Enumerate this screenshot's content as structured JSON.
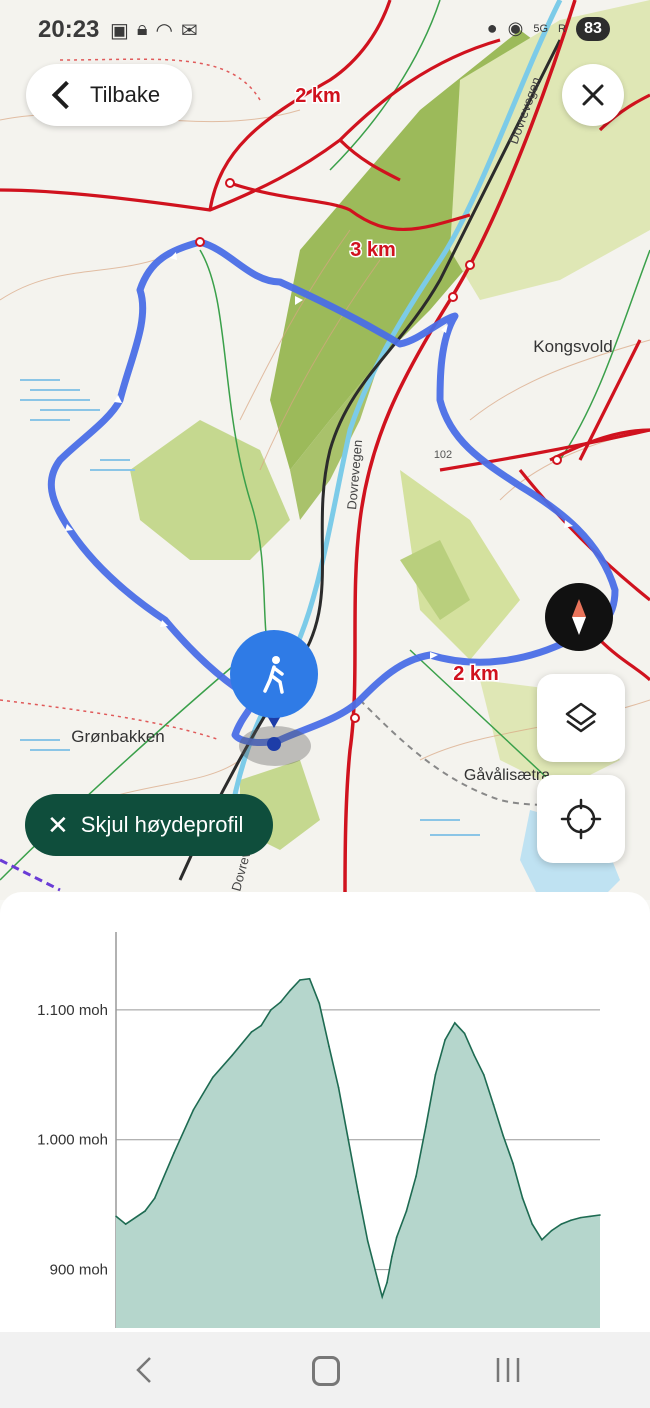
{
  "status_bar": {
    "time": "20:23",
    "left_icons": [
      "screenshot-icon",
      "lock-icon",
      "wifi-icon",
      "mail-icon"
    ],
    "right_icons": [
      "location-icon",
      "hotspot-icon",
      "5g-icon",
      "signal-icon"
    ],
    "battery": "83"
  },
  "header": {
    "back_label": "Tilbake",
    "back_icon": "chevron-left-icon",
    "close_icon": "close-icon"
  },
  "map": {
    "labels": {
      "dist_2km_top": "2 km",
      "dist_3km": "3 km",
      "dist_2km_bottom": "2 km",
      "kongsvold": "Kongsvold",
      "dovrevegen_top": "Dovrevegen",
      "dovrevegen_mid": "Dovrevegen",
      "dovrevegen_bottom": "Dovrevegen",
      "gronbakken": "Grønbakken",
      "gavalisaetra": "Gåvålisætra",
      "elevation_spot": "102"
    },
    "colors": {
      "route": "#4a6ee6",
      "trail": "#d0121e",
      "hiker_marker": "#2f7be6"
    },
    "hiker_icon": "hiker-icon"
  },
  "controls": {
    "compass_icon": "compass-icon",
    "layers_icon": "layers-icon",
    "locate_icon": "crosshair-icon"
  },
  "profile_toggle": {
    "label": "Skjul høydeprofil",
    "icon": "close-icon"
  },
  "chart_data": {
    "type": "area",
    "title": "",
    "xlabel": "",
    "ylabel": "",
    "yticks": [
      "900 moh",
      "1.000 moh",
      "1.100 moh"
    ],
    "ylim": [
      855,
      1160
    ],
    "xlim": [
      0,
      1
    ],
    "grid": true,
    "color": "#b5d6cc",
    "line_color": "#1e6b52",
    "x": [
      0,
      0.02,
      0.06,
      0.08,
      0.12,
      0.16,
      0.2,
      0.24,
      0.28,
      0.3,
      0.32,
      0.34,
      0.36,
      0.38,
      0.4,
      0.42,
      0.44,
      0.46,
      0.48,
      0.5,
      0.52,
      0.54,
      0.55,
      0.56,
      0.57,
      0.58,
      0.6,
      0.62,
      0.64,
      0.66,
      0.68,
      0.7,
      0.72,
      0.74,
      0.76,
      0.78,
      0.8,
      0.82,
      0.84,
      0.86,
      0.88,
      0.9,
      0.92,
      0.94,
      0.96,
      0.98,
      1.0
    ],
    "values": [
      941,
      935,
      945,
      955,
      990,
      1023,
      1048,
      1065,
      1083,
      1088,
      1100,
      1106,
      1115,
      1123,
      1124,
      1105,
      1072,
      1040,
      1000,
      960,
      922,
      893,
      879,
      890,
      910,
      925,
      945,
      972,
      1010,
      1050,
      1077,
      1090,
      1082,
      1065,
      1050,
      1027,
      1003,
      982,
      955,
      935,
      923,
      930,
      935,
      938,
      940,
      941,
      942
    ]
  },
  "nav_bar": {
    "back_icon": "nav-back-icon",
    "home_icon": "nav-home-icon",
    "recent_icon": "nav-recent-icon"
  }
}
